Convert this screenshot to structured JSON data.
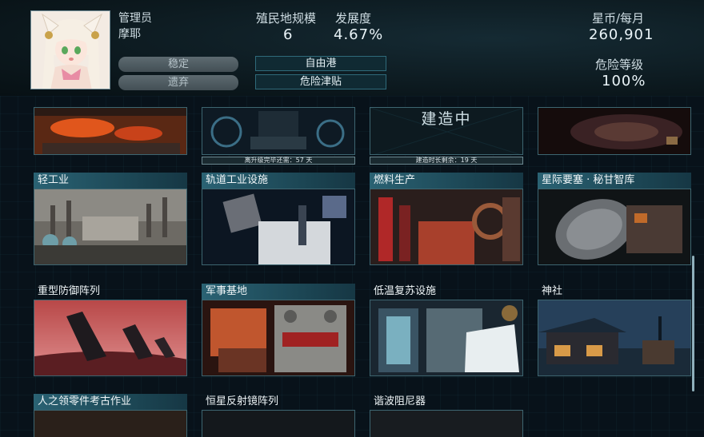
{
  "header": {
    "admin_label": "管理员",
    "admin_name": "摩耶",
    "colony_size_label": "殖民地规模",
    "colony_size_value": "6",
    "development_label": "发展度",
    "development_value": "4.67%",
    "currency_label": "星币/每月",
    "currency_value": "260,901",
    "danger_label": "危险等级",
    "danger_value": "100%",
    "stable_button": "稳定",
    "abandon_button": "遗弃",
    "freeport_button": "自由港",
    "hazard_pay_button": "危险津贴"
  },
  "grid": {
    "row0": {
      "c1_progress_text": "离升级完毕还需：57 天",
      "c1_progress": 0.0,
      "c2_overlay": "建造中",
      "c2_progress_text": "建造时长剩余：19 天",
      "c2_progress": 0.0
    },
    "cards": [
      {
        "title": "轻工业"
      },
      {
        "title": "轨道工业设施"
      },
      {
        "title": "燃料生产"
      },
      {
        "title": "星际要塞 · 秘甘智库"
      },
      {
        "title": "重型防御阵列"
      },
      {
        "title": "军事基地"
      },
      {
        "title": "低温复苏设施"
      },
      {
        "title": "神社"
      },
      {
        "title": "人之领零件考古作业"
      },
      {
        "title": "恒星反射镜阵列"
      },
      {
        "title": "谐波阻尼器"
      }
    ]
  }
}
